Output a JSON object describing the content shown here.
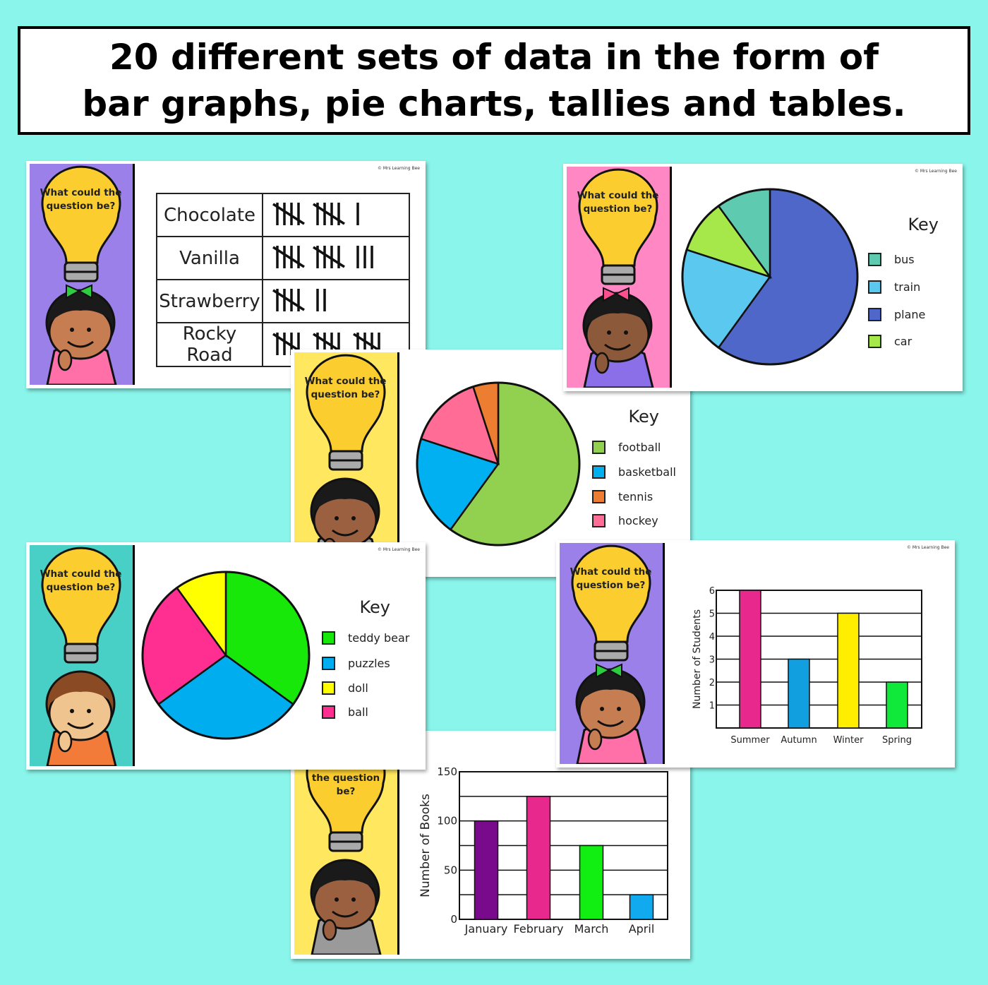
{
  "headline": "20 different sets of data in the form of bar graphs, pie charts, tallies and tables.",
  "prompt_text": "What could the question be?",
  "prompt_partial": "the question be?",
  "copyright": "© Mrs Learning Bee",
  "themes": {
    "purple": {
      "side": "#9b80ea",
      "shirt": "#ff6fa8",
      "skin": "#c77d52",
      "hair": "#1a1a1a",
      "bow": "#2ecc40"
    },
    "pink": {
      "side": "#ff87c3",
      "shirt": "#8a6fe8",
      "skin": "#8c5a3a",
      "hair": "#1a1a1a",
      "bow": "#ff4f8f"
    },
    "yellow": {
      "side": "#ffe85f",
      "shirt": "#9a9a9a",
      "skin": "#9a6040",
      "hair": "#1a1a1a",
      "bow": ""
    },
    "teal": {
      "side": "#48d0c6",
      "shirt": "#f37b3a",
      "skin": "#f0c48f",
      "hair": "#8a4a24",
      "bow": ""
    }
  },
  "chart_data": [
    {
      "type": "table",
      "subtype": "tally",
      "categories": [
        "Chocolate",
        "Vanilla",
        "Strawberry",
        "Rocky Road"
      ],
      "values": [
        11,
        13,
        7,
        15
      ]
    },
    {
      "type": "pie",
      "key_title": "Key",
      "categories": [
        "bus",
        "train",
        "plane",
        "car"
      ],
      "values": [
        10,
        20,
        60,
        10
      ],
      "colors": [
        "#5ecbb0",
        "#5bc8f0",
        "#4e67c8",
        "#a6e84a"
      ]
    },
    {
      "type": "pie",
      "key_title": "Key",
      "categories": [
        "football",
        "basketball",
        "tennis",
        "hockey"
      ],
      "values": [
        60,
        20,
        5,
        15
      ],
      "colors": [
        "#92d050",
        "#00b0f0",
        "#ed7d31",
        "#ff6c96"
      ]
    },
    {
      "type": "pie",
      "key_title": "Key",
      "categories": [
        "teddy bear",
        "puzzles",
        "doll",
        "ball"
      ],
      "values": [
        7,
        6,
        2,
        5
      ],
      "colors": [
        "#17e80a",
        "#00aeef",
        "#ffff00",
        "#ff2f92"
      ]
    },
    {
      "type": "bar",
      "categories": [
        "Summer",
        "Autumn",
        "Winter",
        "Spring"
      ],
      "values": [
        6,
        3,
        5,
        2
      ],
      "colors": [
        "#e8288c",
        "#119fe0",
        "#ffee00",
        "#10e83a"
      ],
      "ylabel": "Number of Students",
      "ylim": [
        0,
        6
      ],
      "yticks": [
        1,
        2,
        3,
        4,
        5,
        6
      ],
      "grid": true
    },
    {
      "type": "bar",
      "categories": [
        "January",
        "February",
        "March",
        "April"
      ],
      "values": [
        100,
        125,
        75,
        25
      ],
      "colors": [
        "#7a0a8c",
        "#e8288c",
        "#11ee11",
        "#11aaee"
      ],
      "ylabel": "Number of Books",
      "ylim": [
        0,
        150
      ],
      "yticks": [
        0,
        50,
        100,
        150
      ],
      "grid": true
    }
  ]
}
